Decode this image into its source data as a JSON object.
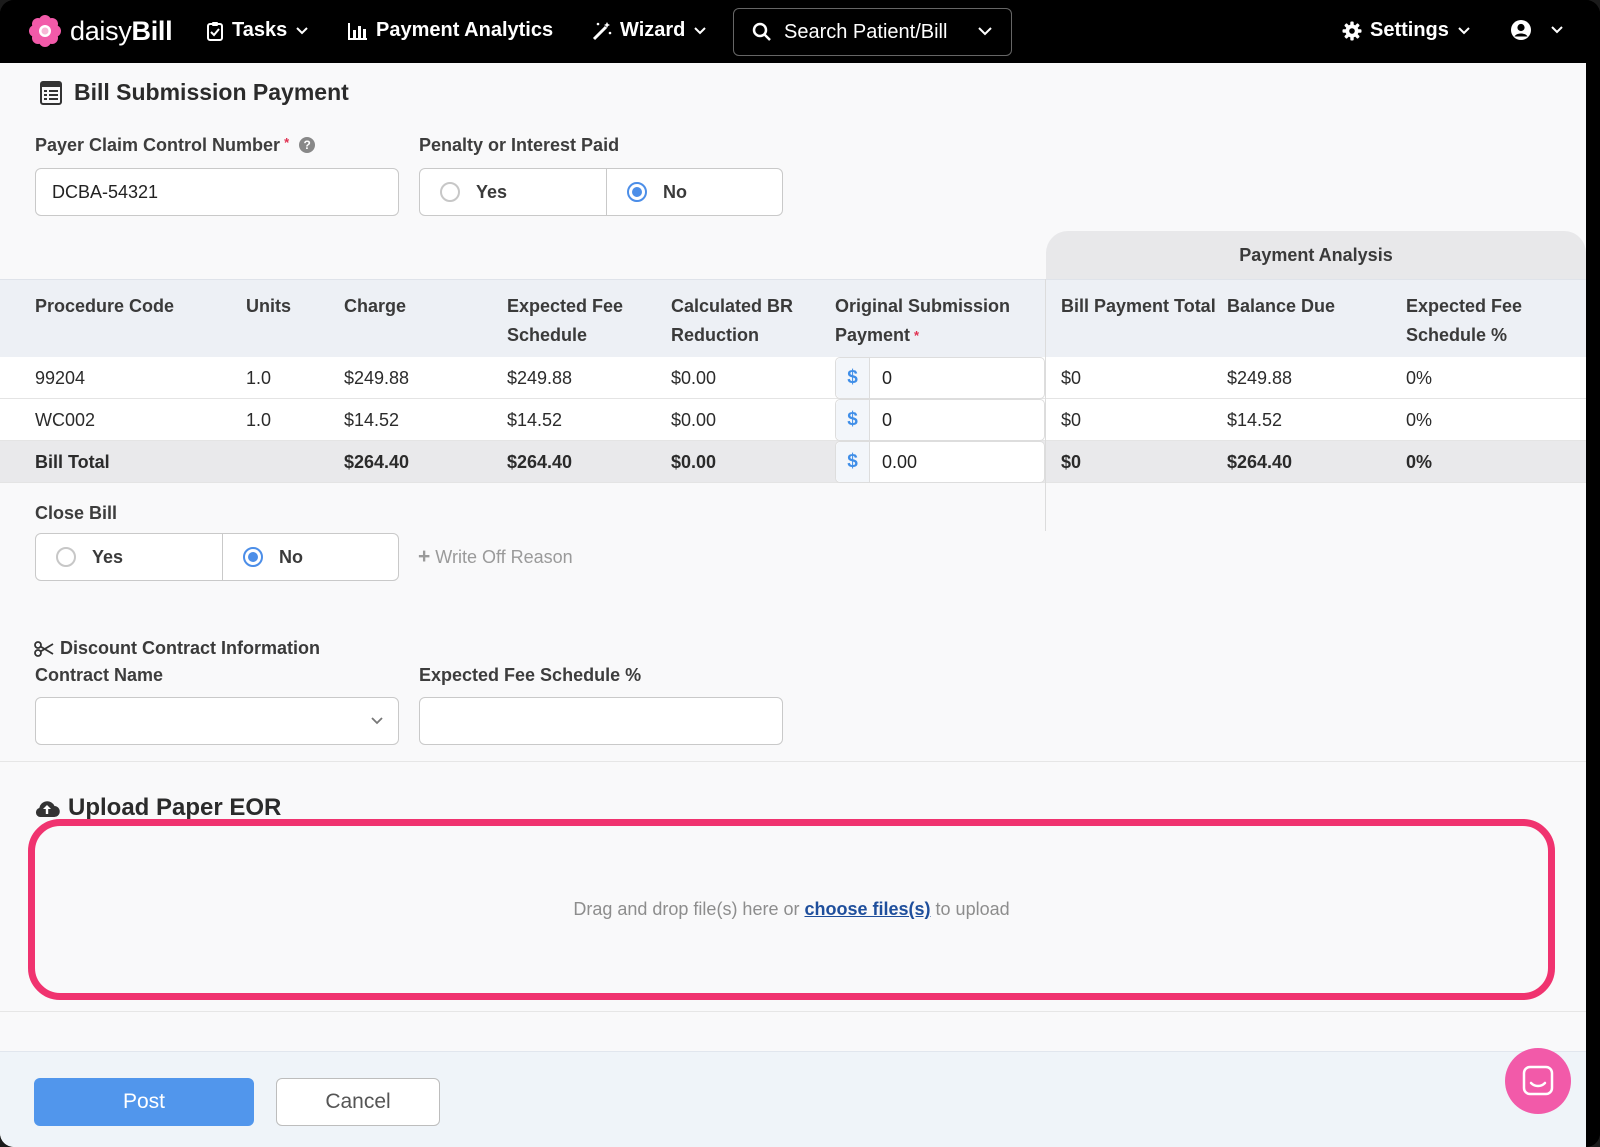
{
  "nav": {
    "brand_regular": "daisy",
    "brand_bold": "Bill",
    "tasks": "Tasks",
    "payment_analytics": "Payment Analytics",
    "wizard": "Wizard",
    "search_label": "Search Patient/Bill",
    "settings": "Settings"
  },
  "page": {
    "title": "Bill Submission Payment"
  },
  "form": {
    "claim_label": "Payer Claim Control Number",
    "claim_required": "*",
    "claim_value": "DCBA-54321",
    "penalty_label": "Penalty or Interest Paid",
    "penalty_yes": "Yes",
    "penalty_no": "No",
    "penalty_selected": "No"
  },
  "table": {
    "analysis_header": "Payment Analysis",
    "columns": {
      "procedure_code": "Procedure Code",
      "units": "Units",
      "charge": "Charge",
      "expected_fee_1": "Expected Fee",
      "expected_fee_2": "Schedule",
      "calc_br_1": "Calculated BR",
      "calc_br_2": "Reduction",
      "orig_pay_1": "Original Submission",
      "orig_pay_2": "Payment",
      "orig_pay_required": "*",
      "bill_payment_total": "Bill Payment Total",
      "balance_due": "Balance Due",
      "expected_pct_1": "Expected Fee",
      "expected_pct_2": "Schedule %"
    },
    "currency_symbol": "$",
    "rows": [
      {
        "code": "99204",
        "units": "1.0",
        "charge": "$249.88",
        "expected": "$249.88",
        "reduction": "$0.00",
        "payment": "0",
        "bill_payment_total": "$0",
        "balance_due": "$249.88",
        "expected_pct": "0%"
      },
      {
        "code": "WC002",
        "units": "1.0",
        "charge": "$14.52",
        "expected": "$14.52",
        "reduction": "$0.00",
        "payment": "0",
        "bill_payment_total": "$0",
        "balance_due": "$14.52",
        "expected_pct": "0%"
      }
    ],
    "total": {
      "label": "Bill Total",
      "charge": "$264.40",
      "expected": "$264.40",
      "reduction": "$0.00",
      "payment": "0.00",
      "bill_payment_total": "$0",
      "balance_due": "$264.40",
      "expected_pct": "0%"
    }
  },
  "close_bill": {
    "label": "Close Bill",
    "yes": "Yes",
    "no": "No",
    "selected": "No",
    "write_off": "Write Off Reason"
  },
  "discount": {
    "heading": "Discount Contract Information",
    "contract_label": "Contract Name",
    "contract_value": "",
    "fee_pct_label": "Expected Fee Schedule %",
    "fee_pct_value": ""
  },
  "upload": {
    "title": "Upload Paper EOR",
    "text_before": "Drag and drop file(s) here or",
    "link": "choose files(s)",
    "text_after": "to upload",
    "highlight_color": "#f0336f"
  },
  "footer": {
    "post": "Post",
    "cancel": "Cancel"
  },
  "colors": {
    "accent": "#5196ec",
    "nav_bg": "#000000",
    "chat_bubble": "#f25aa9"
  }
}
